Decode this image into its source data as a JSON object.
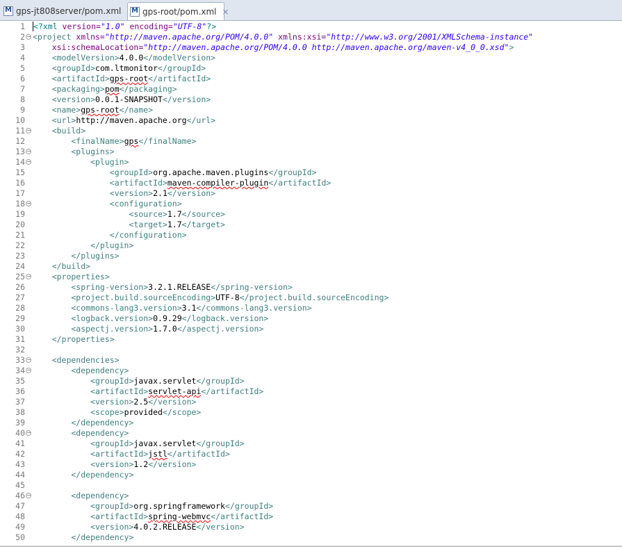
{
  "tabs": [
    {
      "label": "gps-jt808server/pom.xml",
      "active": false
    },
    {
      "label": "gps-root/pom.xml",
      "active": true,
      "close": "×"
    }
  ],
  "editor": {
    "lines": [
      {
        "n": "1",
        "fold": false,
        "segs": [
          [
            "pi",
            "<?xml "
          ],
          [
            "attr",
            "version="
          ],
          [
            "val",
            "\"1.0\""
          ],
          [
            "pi",
            " "
          ],
          [
            "attr",
            "encoding="
          ],
          [
            "val",
            "\"UTF-8\""
          ],
          [
            "pi",
            "?>"
          ]
        ]
      },
      {
        "n": "2",
        "fold": true,
        "segs": [
          [
            "tag",
            "<project "
          ],
          [
            "attr",
            "xmlns="
          ],
          [
            "val",
            "\"http://maven.apache.org/POM/4.0.0\""
          ],
          [
            "tag",
            " "
          ],
          [
            "attr",
            "xmlns:xsi="
          ],
          [
            "val",
            "\"http://www.w3.org/2001/XMLSchema-instance\""
          ]
        ]
      },
      {
        "n": "3",
        "fold": false,
        "segs": [
          [
            "tag",
            "    "
          ],
          [
            "attr",
            "xsi:schemaLocation="
          ],
          [
            "val",
            "\"http://maven.apache.org/POM/4.0.0 http://maven.apache.org/maven-v4_0_0.xsd\""
          ],
          [
            "tag",
            ">"
          ]
        ]
      },
      {
        "n": "4",
        "fold": false,
        "segs": [
          [
            "tag",
            "    <modelVersion>"
          ],
          [
            "txt",
            "4.0.0"
          ],
          [
            "tag",
            "</modelVersion>"
          ]
        ]
      },
      {
        "n": "5",
        "fold": false,
        "segs": [
          [
            "tag",
            "    <groupId>"
          ],
          [
            "txt",
            "com.ltmonitor"
          ],
          [
            "tag",
            "</groupId>"
          ]
        ]
      },
      {
        "n": "6",
        "fold": false,
        "segs": [
          [
            "tag",
            "    <artifactId>"
          ],
          [
            "txt",
            "gps-root"
          ],
          [
            "tag",
            "</artifactId>"
          ]
        ]
      },
      {
        "n": "7",
        "fold": false,
        "segs": [
          [
            "tag",
            "    <packaging>"
          ],
          [
            "txt",
            "pom"
          ],
          [
            "tag",
            "</packaging>"
          ]
        ]
      },
      {
        "n": "8",
        "fold": false,
        "segs": [
          [
            "tag",
            "    <version>"
          ],
          [
            "txt",
            "0.0.1-SNAPSHOT"
          ],
          [
            "tag",
            "</version>"
          ]
        ]
      },
      {
        "n": "9",
        "fold": false,
        "segs": [
          [
            "tag",
            "    <name>"
          ],
          [
            "txt",
            "gps-root"
          ],
          [
            "tag",
            "</name>"
          ]
        ]
      },
      {
        "n": "10",
        "fold": false,
        "segs": [
          [
            "tag",
            "    <url>"
          ],
          [
            "txt",
            "http://maven.apache.org"
          ],
          [
            "tag",
            "</url>"
          ]
        ]
      },
      {
        "n": "11",
        "fold": true,
        "segs": [
          [
            "tag",
            "    <build>"
          ]
        ]
      },
      {
        "n": "12",
        "fold": false,
        "segs": [
          [
            "tag",
            "        <finalName>"
          ],
          [
            "txt",
            "gps"
          ],
          [
            "tag",
            "</finalName>"
          ]
        ]
      },
      {
        "n": "13",
        "fold": true,
        "segs": [
          [
            "tag",
            "        <plugins>"
          ]
        ]
      },
      {
        "n": "14",
        "fold": true,
        "segs": [
          [
            "tag",
            "            <plugin>"
          ]
        ]
      },
      {
        "n": "15",
        "fold": false,
        "segs": [
          [
            "tag",
            "                <groupId>"
          ],
          [
            "txt",
            "org.apache.maven.plugins"
          ],
          [
            "tag",
            "</groupId>"
          ]
        ]
      },
      {
        "n": "16",
        "fold": false,
        "segs": [
          [
            "tag",
            "                <artifactId>"
          ],
          [
            "txt",
            "maven-compiler-plugin"
          ],
          [
            "tag",
            "</artifactId>"
          ]
        ]
      },
      {
        "n": "17",
        "fold": false,
        "segs": [
          [
            "tag",
            "                <version>"
          ],
          [
            "txt",
            "2.1"
          ],
          [
            "tag",
            "</version>"
          ]
        ]
      },
      {
        "n": "18",
        "fold": true,
        "segs": [
          [
            "tag",
            "                <configuration>"
          ]
        ]
      },
      {
        "n": "19",
        "fold": false,
        "segs": [
          [
            "tag",
            "                    <source>"
          ],
          [
            "txt",
            "1.7"
          ],
          [
            "tag",
            "</source>"
          ]
        ]
      },
      {
        "n": "20",
        "fold": false,
        "segs": [
          [
            "tag",
            "                    <target>"
          ],
          [
            "txt",
            "1.7"
          ],
          [
            "tag",
            "</target>"
          ]
        ]
      },
      {
        "n": "21",
        "fold": false,
        "segs": [
          [
            "tag",
            "                </configuration>"
          ]
        ]
      },
      {
        "n": "22",
        "fold": false,
        "segs": [
          [
            "tag",
            "            </plugin>"
          ]
        ]
      },
      {
        "n": "23",
        "fold": false,
        "segs": [
          [
            "tag",
            "        </plugins>"
          ]
        ]
      },
      {
        "n": "24",
        "fold": false,
        "segs": [
          [
            "tag",
            "    </build>"
          ]
        ]
      },
      {
        "n": "25",
        "fold": true,
        "segs": [
          [
            "tag",
            "    <properties>"
          ]
        ]
      },
      {
        "n": "26",
        "fold": false,
        "segs": [
          [
            "tag",
            "        <spring-version>"
          ],
          [
            "txt",
            "3.2.1.RELEASE"
          ],
          [
            "tag",
            "</spring-version>"
          ]
        ]
      },
      {
        "n": "27",
        "fold": false,
        "segs": [
          [
            "tag",
            "        <project.build.sourceEncoding>"
          ],
          [
            "txt",
            "UTF-8"
          ],
          [
            "tag",
            "</project.build.sourceEncoding>"
          ]
        ]
      },
      {
        "n": "28",
        "fold": false,
        "segs": [
          [
            "tag",
            "        <commons-lang3.version>"
          ],
          [
            "txt",
            "3.1"
          ],
          [
            "tag",
            "</commons-lang3.version>"
          ]
        ]
      },
      {
        "n": "29",
        "fold": false,
        "segs": [
          [
            "tag",
            "        <logback.version>"
          ],
          [
            "txt",
            "0.9.29"
          ],
          [
            "tag",
            "</logback.version>"
          ]
        ]
      },
      {
        "n": "30",
        "fold": false,
        "segs": [
          [
            "tag",
            "        <aspectj.version>"
          ],
          [
            "txt",
            "1.7.0"
          ],
          [
            "tag",
            "</aspectj.version>"
          ]
        ]
      },
      {
        "n": "31",
        "fold": false,
        "segs": [
          [
            "tag",
            "    </properties>"
          ]
        ]
      },
      {
        "n": "32",
        "fold": false,
        "segs": []
      },
      {
        "n": "33",
        "fold": true,
        "segs": [
          [
            "tag",
            "    <dependencies>"
          ]
        ]
      },
      {
        "n": "34",
        "fold": true,
        "segs": [
          [
            "tag",
            "        <dependency>"
          ]
        ]
      },
      {
        "n": "35",
        "fold": false,
        "segs": [
          [
            "tag",
            "            <groupId>"
          ],
          [
            "txt",
            "javax.servlet"
          ],
          [
            "tag",
            "</groupId>"
          ]
        ]
      },
      {
        "n": "36",
        "fold": false,
        "segs": [
          [
            "tag",
            "            <artifactId>"
          ],
          [
            "txt",
            "servlet-api"
          ],
          [
            "tag",
            "</artifactId>"
          ]
        ]
      },
      {
        "n": "37",
        "fold": false,
        "segs": [
          [
            "tag",
            "            <version>"
          ],
          [
            "txt",
            "2.5"
          ],
          [
            "tag",
            "</version>"
          ]
        ]
      },
      {
        "n": "38",
        "fold": false,
        "segs": [
          [
            "tag",
            "            <scope>"
          ],
          [
            "txt",
            "provided"
          ],
          [
            "tag",
            "</scope>"
          ]
        ]
      },
      {
        "n": "39",
        "fold": false,
        "segs": [
          [
            "tag",
            "        </dependency>"
          ]
        ]
      },
      {
        "n": "40",
        "fold": true,
        "segs": [
          [
            "tag",
            "        <dependency>"
          ]
        ]
      },
      {
        "n": "41",
        "fold": false,
        "segs": [
          [
            "tag",
            "            <groupId>"
          ],
          [
            "txt",
            "javax.servlet"
          ],
          [
            "tag",
            "</groupId>"
          ]
        ]
      },
      {
        "n": "42",
        "fold": false,
        "segs": [
          [
            "tag",
            "            <artifactId>"
          ],
          [
            "txt",
            "jstl"
          ],
          [
            "tag",
            "</artifactId>"
          ]
        ]
      },
      {
        "n": "43",
        "fold": false,
        "segs": [
          [
            "tag",
            "            <version>"
          ],
          [
            "txt",
            "1.2"
          ],
          [
            "tag",
            "</version>"
          ]
        ]
      },
      {
        "n": "44",
        "fold": false,
        "segs": [
          [
            "tag",
            "        </dependency>"
          ]
        ]
      },
      {
        "n": "45",
        "fold": false,
        "segs": []
      },
      {
        "n": "46",
        "fold": true,
        "segs": [
          [
            "tag",
            "        <dependency>"
          ]
        ]
      },
      {
        "n": "47",
        "fold": false,
        "segs": [
          [
            "tag",
            "            <groupId>"
          ],
          [
            "txt",
            "org.springframework"
          ],
          [
            "tag",
            "</groupId>"
          ]
        ]
      },
      {
        "n": "48",
        "fold": false,
        "segs": [
          [
            "tag",
            "            <artifactId>"
          ],
          [
            "txt",
            "spring-webmvc"
          ],
          [
            "tag",
            "</artifactId>"
          ]
        ]
      },
      {
        "n": "49",
        "fold": false,
        "segs": [
          [
            "tag",
            "            <version>"
          ],
          [
            "txt",
            "4.0.2.RELEASE"
          ],
          [
            "tag",
            "</version>"
          ]
        ]
      },
      {
        "n": "50",
        "fold": false,
        "segs": [
          [
            "tag",
            "        </dependency>"
          ]
        ]
      }
    ]
  }
}
